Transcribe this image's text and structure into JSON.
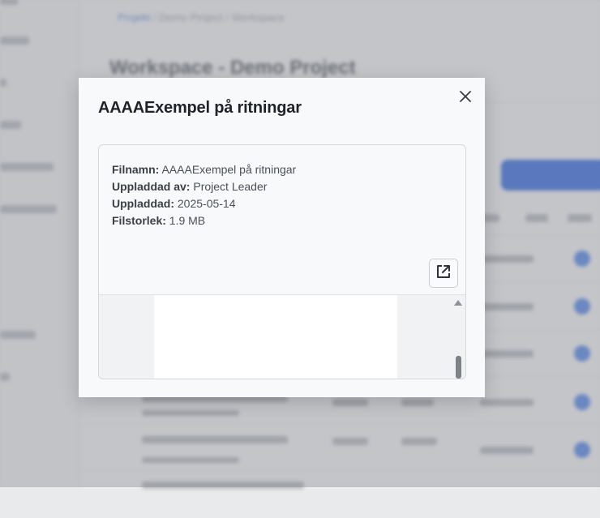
{
  "background": {
    "breadcrumb": {
      "first": "Projekt",
      "rest": " / Demo Project / Workspace"
    },
    "page_title": "Workspace - Demo Project"
  },
  "modal": {
    "title": "AAAAExempel på ritningar",
    "close_icon": "close-icon",
    "file_info": {
      "filename_label": "Filnamn:",
      "filename_value": "AAAAExempel på ritningar",
      "uploaded_by_label": "Uppladdad av:",
      "uploaded_by_value": "Project Leader",
      "uploaded_label": "Uppladdad:",
      "uploaded_value": "2025-05-14",
      "filesize_label": "Filstorlek:",
      "filesize_value": "1.9 MB"
    },
    "open_external_icon": "open-in-new-icon"
  },
  "colors": {
    "accent": "#3b6fe0",
    "title": "#1f2329",
    "text": "#4a4f57"
  }
}
